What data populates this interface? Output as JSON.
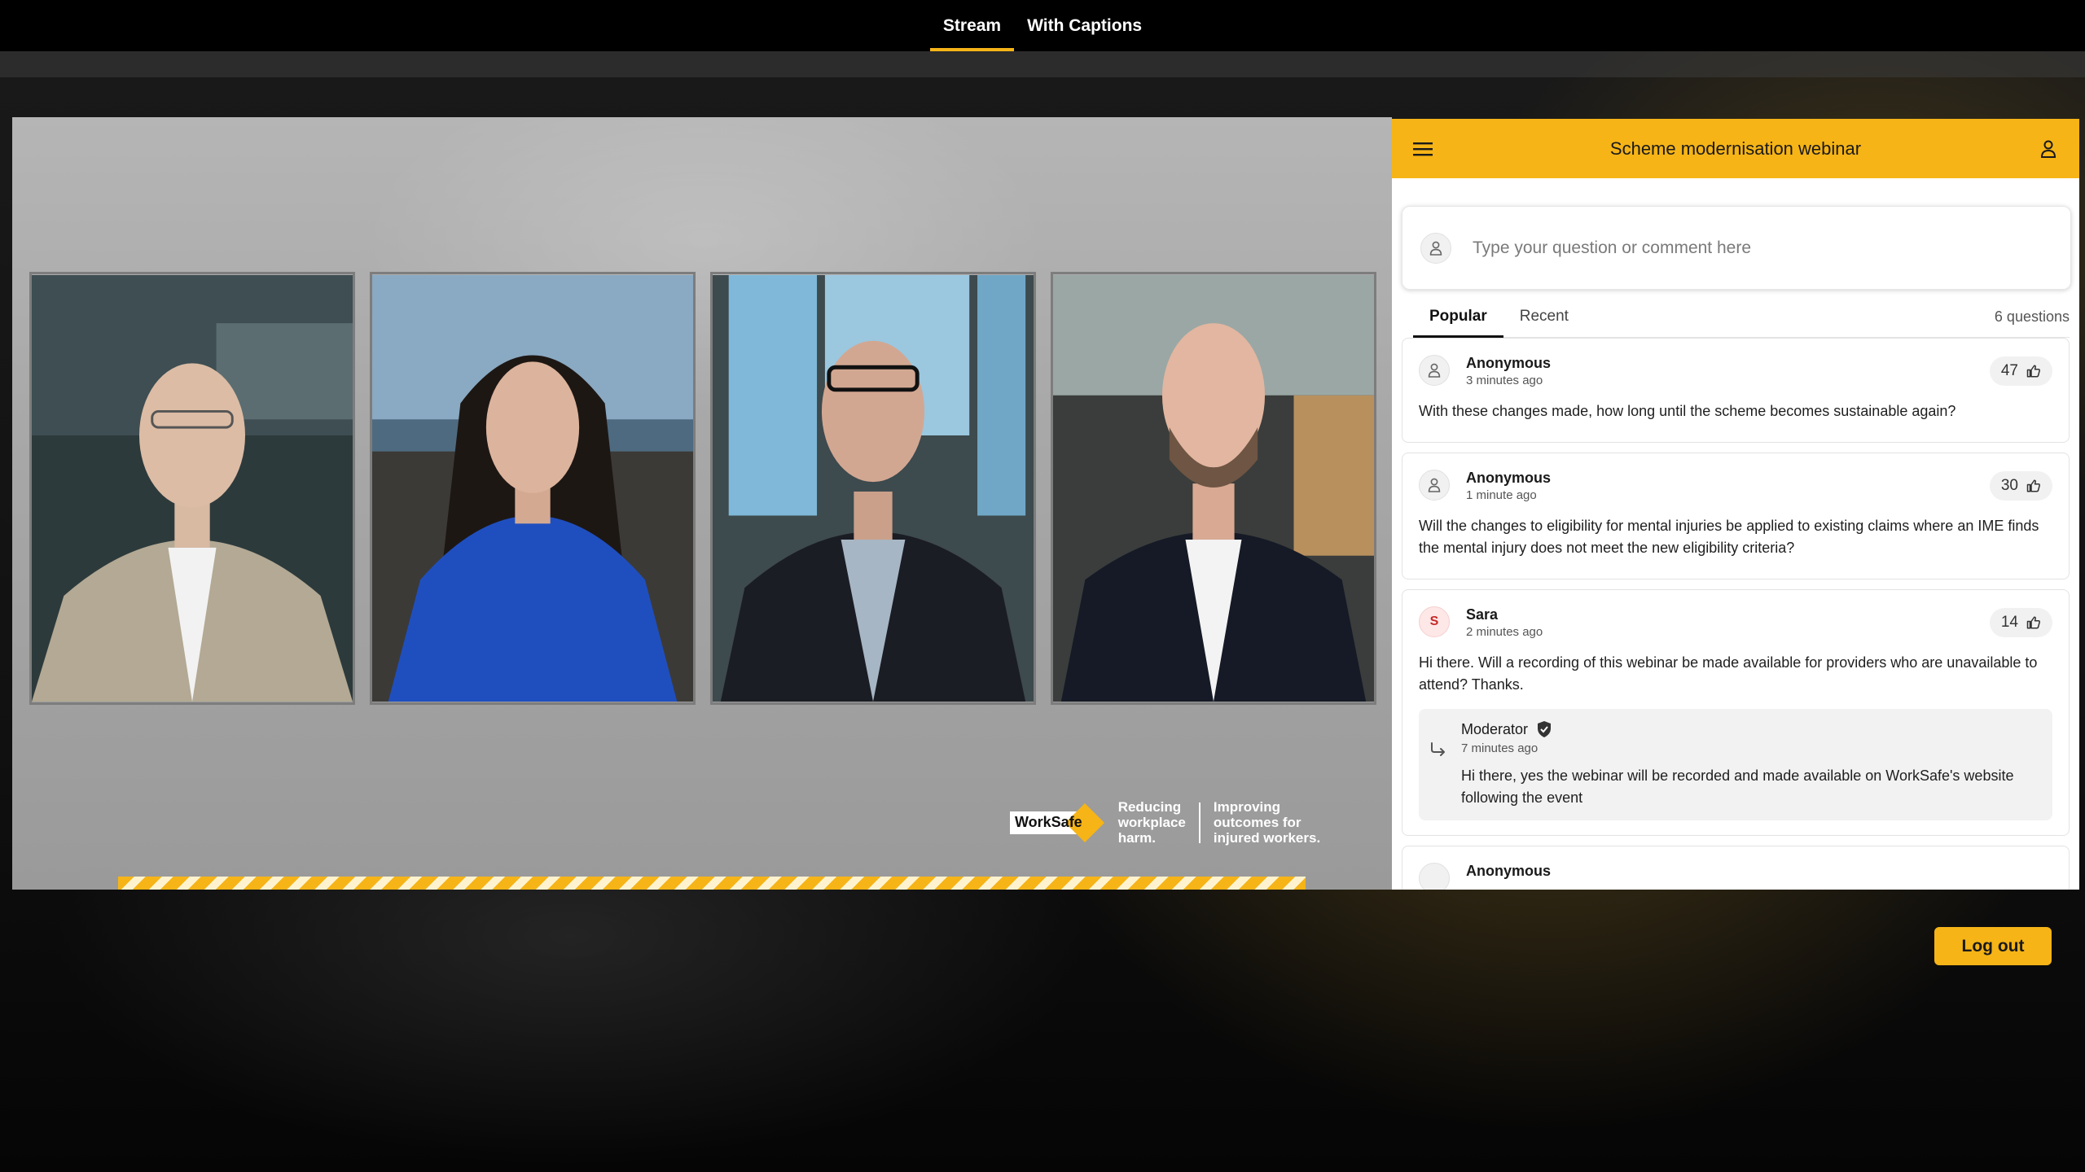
{
  "top_tabs": [
    {
      "label": "Stream",
      "active": true
    },
    {
      "label": "With Captions",
      "active": false
    }
  ],
  "video": {
    "participants": [
      "speaker-1",
      "speaker-2",
      "speaker-3",
      "speaker-4"
    ],
    "logo_text": "WorkSafe",
    "slogan_1": [
      "Reducing",
      "workplace",
      "harm."
    ],
    "slogan_2": [
      "Improving",
      "outcomes for",
      "injured workers."
    ]
  },
  "panel": {
    "title": "Scheme modernisation webinar",
    "menu_icon": "hamburger-menu-icon",
    "user_icon": "user-icon",
    "input_placeholder": "Type your question or comment here",
    "tabs": [
      {
        "label": "Popular",
        "active": true
      },
      {
        "label": "Recent",
        "active": false
      }
    ],
    "question_count": "6 questions",
    "questions": [
      {
        "author": "Anonymous",
        "time": "3 minutes ago",
        "votes": "47",
        "text": "With these changes made, how long until the scheme becomes sustainable again?"
      },
      {
        "author": "Anonymous",
        "time": "1 minute ago",
        "votes": "30",
        "text": "Will the changes to eligibility for mental injuries be applied to existing claims where an IME finds the mental injury does not meet the new eligibility criteria?"
      },
      {
        "author": "Sara",
        "initial": "S",
        "time": "2 minutes ago",
        "votes": "14",
        "text": "Hi there. Will a recording of this webinar be made available for providers who are unavailable to attend? Thanks.",
        "reply": {
          "author": "Moderator",
          "time": "7 minutes ago",
          "text": "Hi there, yes the webinar will be recorded and made available on WorkSafe's website following the event"
        }
      },
      {
        "author": "Anonymous"
      }
    ]
  },
  "logout_label": "Log out",
  "colors": {
    "accent": "#f6b417",
    "topbar": "#000000",
    "panel_bg": "#ffffff"
  }
}
